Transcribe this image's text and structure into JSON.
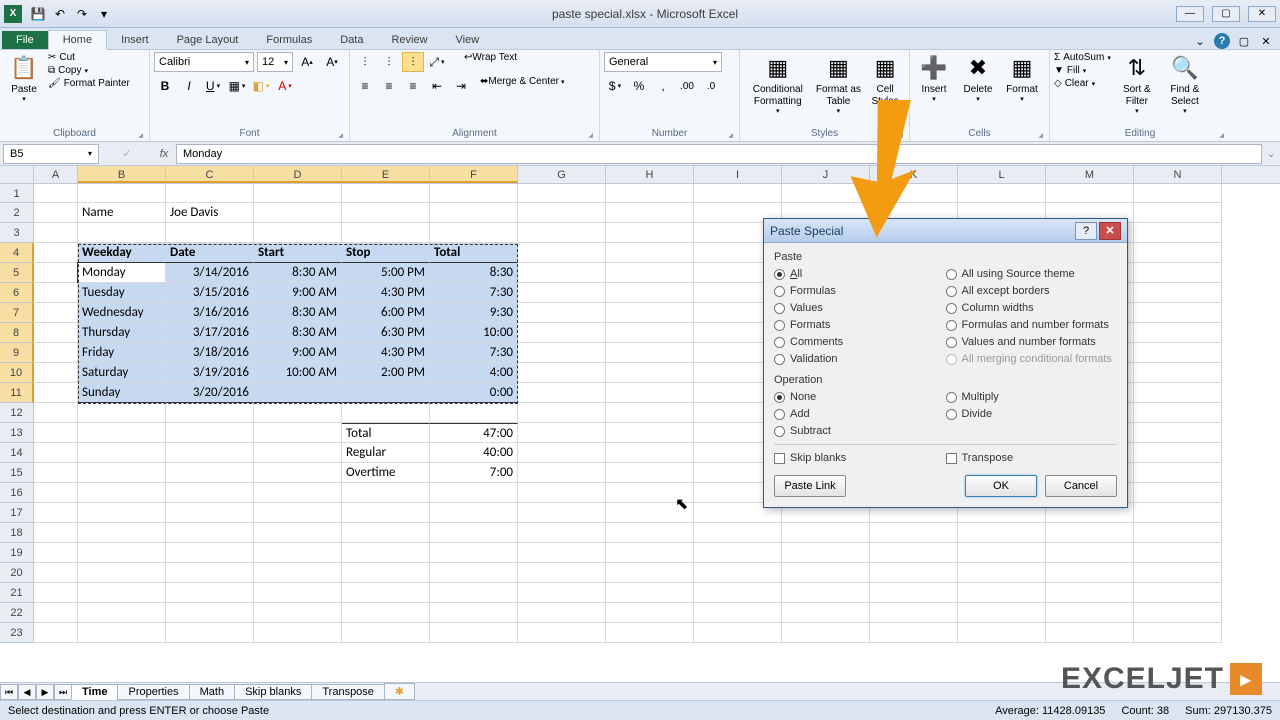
{
  "app": {
    "title": "paste special.xlsx - Microsoft Excel"
  },
  "qat": {
    "save": "💾",
    "undo": "↶",
    "redo": "↷"
  },
  "tabs": [
    "File",
    "Home",
    "Insert",
    "Page Layout",
    "Formulas",
    "Data",
    "Review",
    "View"
  ],
  "ribbon": {
    "clipboard": {
      "label": "Clipboard",
      "paste": "Paste",
      "cut": "Cut",
      "copy": "Copy",
      "fmtpaint": "Format Painter"
    },
    "font": {
      "label": "Font",
      "name": "Calibri",
      "size": "12"
    },
    "alignment": {
      "label": "Alignment",
      "wrap": "Wrap Text",
      "merge": "Merge & Center"
    },
    "number": {
      "label": "Number",
      "format": "General"
    },
    "styles": {
      "label": "Styles",
      "cond": "Conditional Formatting",
      "fmttbl": "Format as Table",
      "cellst": "Cell Styles"
    },
    "cells": {
      "label": "Cells",
      "insert": "Insert",
      "delete": "Delete",
      "format": "Format"
    },
    "editing": {
      "label": "Editing",
      "sum": "AutoSum",
      "fill": "Fill",
      "clear": "Clear",
      "sort": "Sort & Filter",
      "find": "Find & Select"
    }
  },
  "namebox": "B5",
  "formula": "Monday",
  "columns": [
    "A",
    "B",
    "C",
    "D",
    "E",
    "F",
    "G",
    "H",
    "I",
    "J",
    "K",
    "L",
    "M",
    "N"
  ],
  "rows": 23,
  "sheet": {
    "B2": "Name",
    "C2": "Joe Davis",
    "headers": [
      "Weekday",
      "Date",
      "Start",
      "Stop",
      "Total"
    ],
    "data": [
      [
        "Monday",
        "3/14/2016",
        "8:30 AM",
        "5:00 PM",
        "8:30"
      ],
      [
        "Tuesday",
        "3/15/2016",
        "9:00 AM",
        "4:30 PM",
        "7:30"
      ],
      [
        "Wednesday",
        "3/16/2016",
        "8:30 AM",
        "6:00 PM",
        "9:30"
      ],
      [
        "Thursday",
        "3/17/2016",
        "8:30 AM",
        "6:30 PM",
        "10:00"
      ],
      [
        "Friday",
        "3/18/2016",
        "9:00 AM",
        "4:30 PM",
        "7:30"
      ],
      [
        "Saturday",
        "3/19/2016",
        "10:00 AM",
        "2:00 PM",
        "4:00"
      ],
      [
        "Sunday",
        "3/20/2016",
        "",
        "",
        "0:00"
      ]
    ],
    "summary": [
      [
        "Total",
        "47:00"
      ],
      [
        "Regular",
        "40:00"
      ],
      [
        "Overtime",
        "7:00"
      ]
    ]
  },
  "dialog": {
    "title": "Paste Special",
    "paste_label": "Paste",
    "paste_left": [
      "All",
      "Formulas",
      "Values",
      "Formats",
      "Comments",
      "Validation"
    ],
    "paste_right": [
      "All using Source theme",
      "All except borders",
      "Column widths",
      "Formulas and number formats",
      "Values and number formats",
      "All merging conditional formats"
    ],
    "op_label": "Operation",
    "op_left": [
      "None",
      "Add",
      "Subtract"
    ],
    "op_right": [
      "Multiply",
      "Divide"
    ],
    "skip": "Skip blanks",
    "transpose": "Transpose",
    "pastelink": "Paste Link",
    "ok": "OK",
    "cancel": "Cancel"
  },
  "sheettabs": [
    "Time",
    "Properties",
    "Math",
    "Skip blanks",
    "Transpose"
  ],
  "status": {
    "msg": "Select destination and press ENTER or choose Paste",
    "avg": "Average: 11428.09135",
    "count": "Count: 38",
    "sum": "Sum: 297130.375"
  },
  "logo": "EXCELJET"
}
